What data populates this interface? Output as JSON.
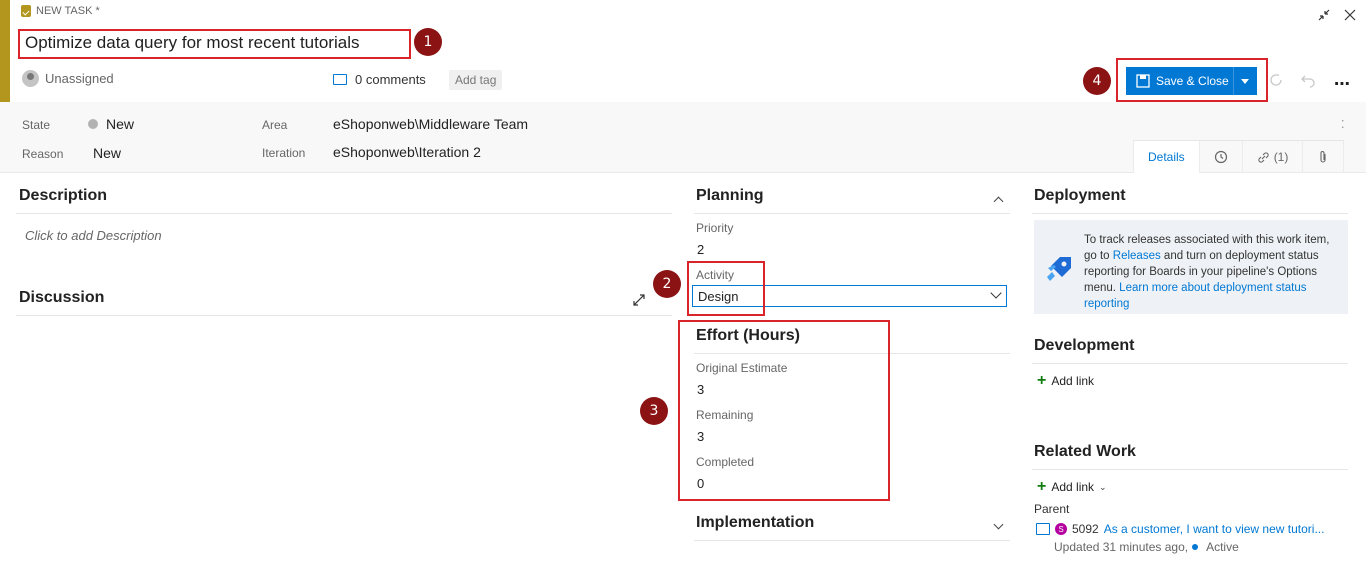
{
  "header": {
    "task_kind": "NEW TASK *",
    "title": "Optimize data query for most recent tutorials",
    "assignee": "Unassigned",
    "comments": "0 comments",
    "add_tag": "Add tag",
    "save_label": "Save & Close"
  },
  "fields": {
    "state_label": "State",
    "state_value": "New",
    "reason_label": "Reason",
    "reason_value": "New",
    "area_label": "Area",
    "area_value": "eShoponweb\\Middleware Team",
    "iteration_label": "Iteration",
    "iteration_value": "eShoponweb\\Iteration 2"
  },
  "tabs": {
    "details": "Details",
    "links": "(1)"
  },
  "left": {
    "description_title": "Description",
    "description_placeholder": "Click to add Description",
    "discussion_title": "Discussion"
  },
  "planning": {
    "title": "Planning",
    "priority_label": "Priority",
    "priority_value": "2",
    "activity_label": "Activity",
    "activity_value": "Design"
  },
  "effort": {
    "title": "Effort (Hours)",
    "original_label": "Original Estimate",
    "original_value": "3",
    "remaining_label": "Remaining",
    "remaining_value": "3",
    "completed_label": "Completed",
    "completed_value": "0"
  },
  "implementation": {
    "title": "Implementation"
  },
  "deployment": {
    "title": "Deployment",
    "text_1": "To track releases associated with this work item, go to ",
    "releases_link": "Releases",
    "text_2": " and turn on deployment status reporting for Boards in your pipeline's Options menu. ",
    "learn_link": "Learn more about deployment status reporting"
  },
  "development": {
    "title": "Development",
    "add_link": "Add link"
  },
  "related": {
    "title": "Related Work",
    "add_link": "Add link",
    "parent_label": "Parent",
    "parent_avatar": "S",
    "parent_id": "5092",
    "parent_title": "As a customer, I want to view new tutori...",
    "parent_updated": "Updated 31 minutes ago,",
    "parent_state": "Active"
  },
  "annotations": [
    "1",
    "2",
    "3",
    "4"
  ],
  "colors": {
    "accent": "#0078d4",
    "task_bar": "#b2961e",
    "annotation": "#d9252a",
    "badge": "#8b1313"
  }
}
